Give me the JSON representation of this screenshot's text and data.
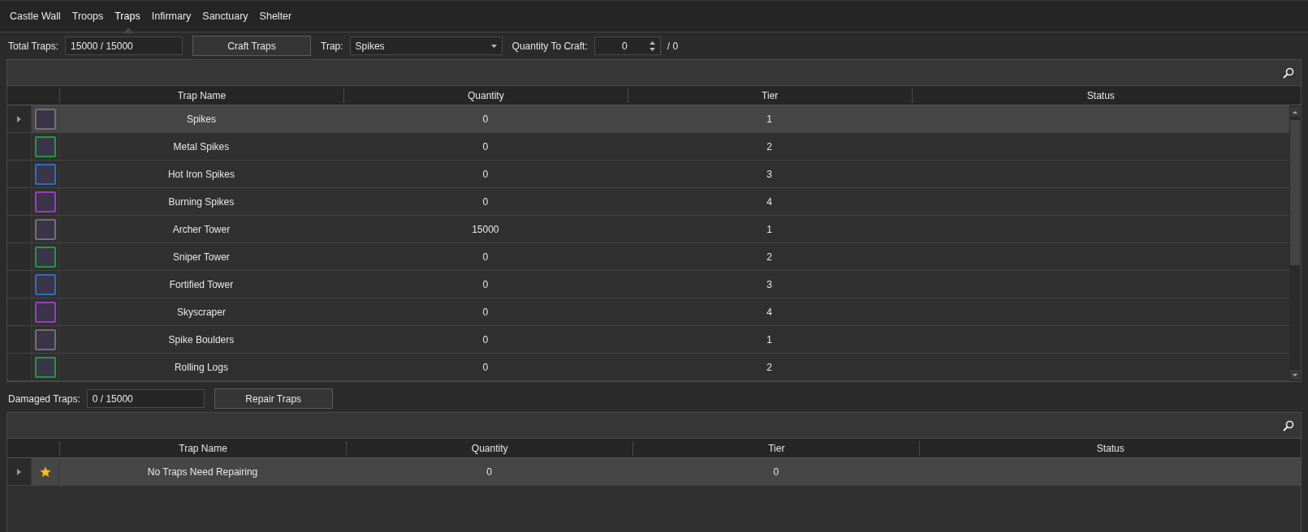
{
  "tabs": [
    {
      "label": "Castle Wall",
      "selected": false
    },
    {
      "label": "Troops",
      "selected": false
    },
    {
      "label": "Traps",
      "selected": true
    },
    {
      "label": "Infirmary",
      "selected": false
    },
    {
      "label": "Sanctuary",
      "selected": false
    },
    {
      "label": "Shelter",
      "selected": false
    }
  ],
  "craft_bar": {
    "total_label": "Total Traps:",
    "total_value": "15000 / 15000",
    "craft_button": "Craft Traps",
    "trap_label": "Trap:",
    "trap_value": "Spikes",
    "quantity_label": "Quantity To Craft:",
    "quantity_value": "0",
    "quantity_max": "/ 0"
  },
  "traps_table": {
    "columns": [
      "Trap Name",
      "Quantity",
      "Tier",
      "Status"
    ],
    "rows": [
      {
        "name": "Spikes",
        "quantity": "0",
        "tier": "1",
        "color": "#707070",
        "selected": true
      },
      {
        "name": "Metal Spikes",
        "quantity": "0",
        "tier": "2",
        "color": "#1f9a3c",
        "selected": false
      },
      {
        "name": "Hot Iron Spikes",
        "quantity": "0",
        "tier": "3",
        "color": "#2a6fc0",
        "selected": false
      },
      {
        "name": "Burning Spikes",
        "quantity": "0",
        "tier": "4",
        "color": "#9a3cc0",
        "selected": false
      },
      {
        "name": "Archer Tower",
        "quantity": "15000",
        "tier": "1",
        "color": "#707070",
        "selected": false
      },
      {
        "name": "Sniper Tower",
        "quantity": "0",
        "tier": "2",
        "color": "#1f9a3c",
        "selected": false
      },
      {
        "name": "Fortified Tower",
        "quantity": "0",
        "tier": "3",
        "color": "#2a6fc0",
        "selected": false
      },
      {
        "name": "Skyscraper",
        "quantity": "0",
        "tier": "4",
        "color": "#9a3cc0",
        "selected": false
      },
      {
        "name": "Spike Boulders",
        "quantity": "0",
        "tier": "1",
        "color": "#707070",
        "selected": false
      },
      {
        "name": "Rolling Logs",
        "quantity": "0",
        "tier": "2",
        "color": "#1f9a3c",
        "selected": false
      }
    ]
  },
  "repair_bar": {
    "damaged_label": "Damaged Traps:",
    "damaged_value": "0 / 15000",
    "repair_button": "Repair Traps"
  },
  "repair_table": {
    "columns": [
      "Trap Name",
      "Quantity",
      "Tier",
      "Status"
    ],
    "rows": [
      {
        "name": "No Traps Need Repairing",
        "quantity": "0",
        "tier": "0",
        "selected": true
      }
    ]
  }
}
